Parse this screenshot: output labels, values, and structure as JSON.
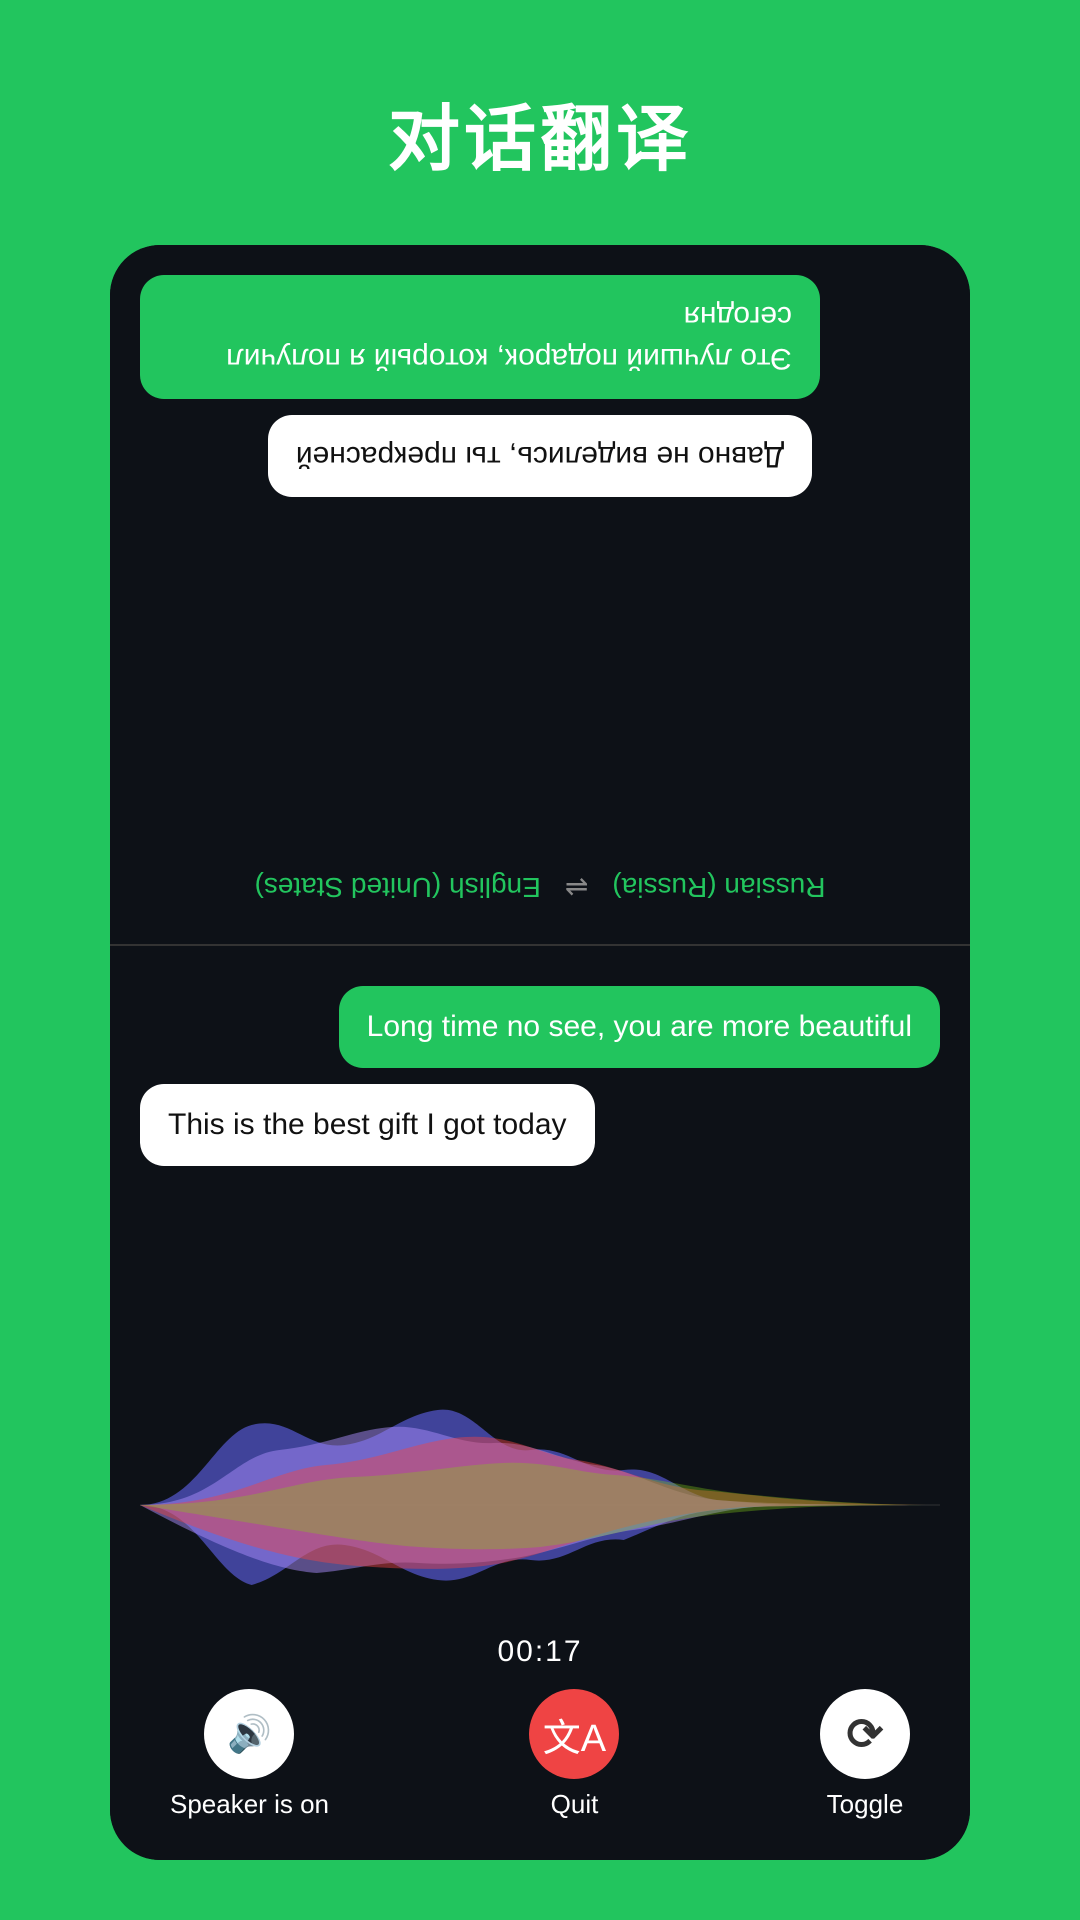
{
  "app": {
    "title": "对话翻译",
    "background_color": "#22c55e"
  },
  "language_bar": {
    "left_lang": "English (United States)",
    "swap_symbol": "⇌",
    "right_lang": "Russian (Russia)"
  },
  "top_messages": [
    {
      "type": "green",
      "text": "Это лучший подарок, который я получил сегодня",
      "reversed": true
    },
    {
      "type": "white",
      "text": "Давно не виделись, ты прекрасней",
      "reversed": true
    }
  ],
  "bottom_messages": [
    {
      "type": "green",
      "text": "Long time no see, you are more beautiful"
    },
    {
      "type": "white",
      "text": "This is the best gift I got today"
    }
  ],
  "timer": {
    "value": "00:17"
  },
  "controls": {
    "speaker": {
      "label": "Speaker is on",
      "icon": "speaker"
    },
    "quit": {
      "label": "Quit",
      "icon": "translate"
    },
    "toggle": {
      "label": "Toggle",
      "icon": "refresh"
    }
  }
}
